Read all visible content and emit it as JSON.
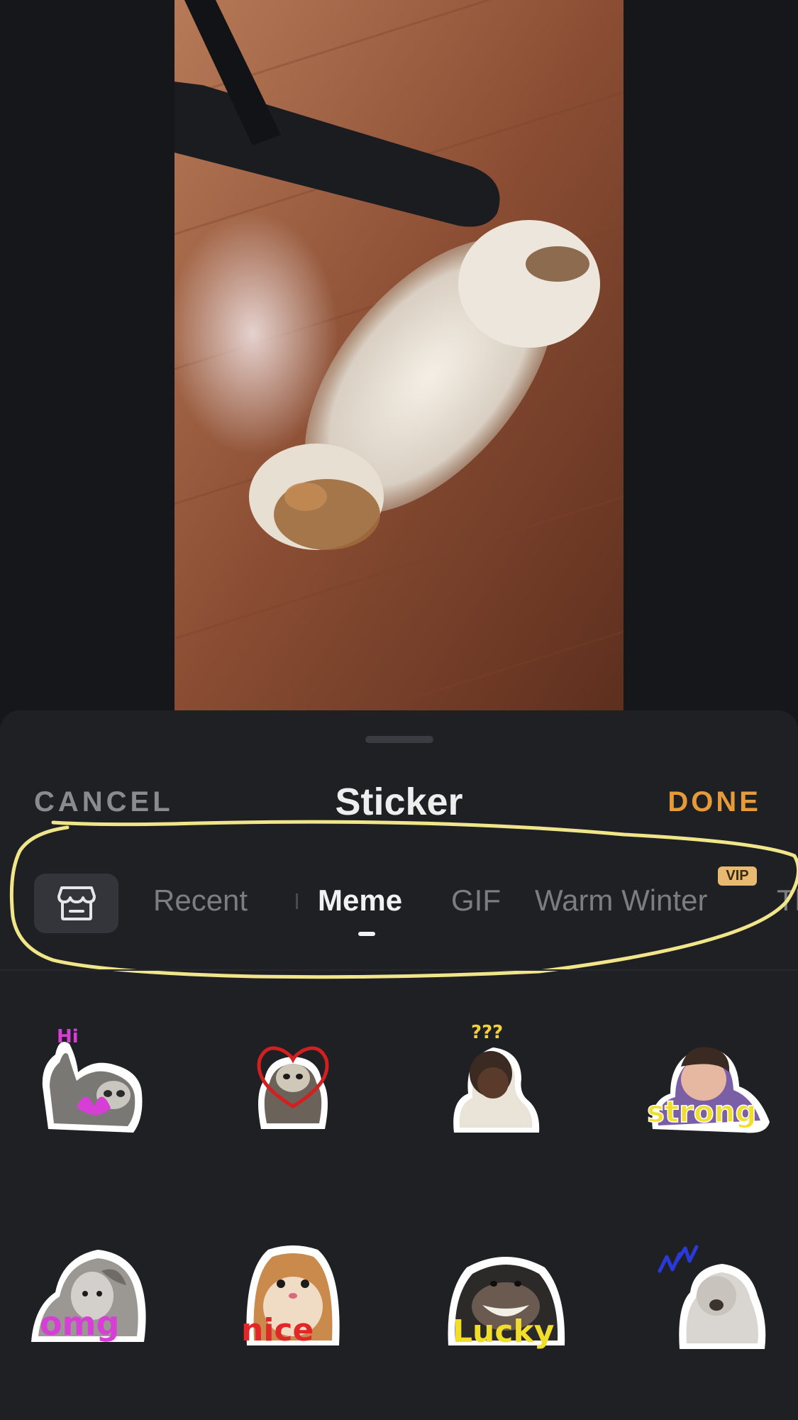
{
  "header": {
    "cancel_label": "CANCEL",
    "title": "Sticker",
    "done_label": "DONE"
  },
  "tabs": {
    "store_icon": "store-icon",
    "items": [
      {
        "label": "Recent",
        "active": false
      },
      {
        "label": "Meme",
        "active": true
      },
      {
        "label": "GIF",
        "active": false
      },
      {
        "label": "Warm Winter",
        "active": false,
        "badge": "VIP"
      },
      {
        "label": "Th",
        "active": false
      }
    ]
  },
  "stickers": [
    {
      "name": "sloth-hi",
      "caption": "Hi"
    },
    {
      "name": "sloth-heart",
      "caption": ""
    },
    {
      "name": "girl-question",
      "caption": "???"
    },
    {
      "name": "boy-strong",
      "caption": "strong"
    },
    {
      "name": "girl-omg",
      "caption": "omg"
    },
    {
      "name": "hamster-nice",
      "caption": "nice"
    },
    {
      "name": "chimp-lucky",
      "caption": "Lucky"
    },
    {
      "name": "baby-shout",
      "caption": ""
    }
  ],
  "colors": {
    "accent": "#e79a3a",
    "highlight_ring": "#f1e58a",
    "vip_badge": "#e8b970"
  }
}
